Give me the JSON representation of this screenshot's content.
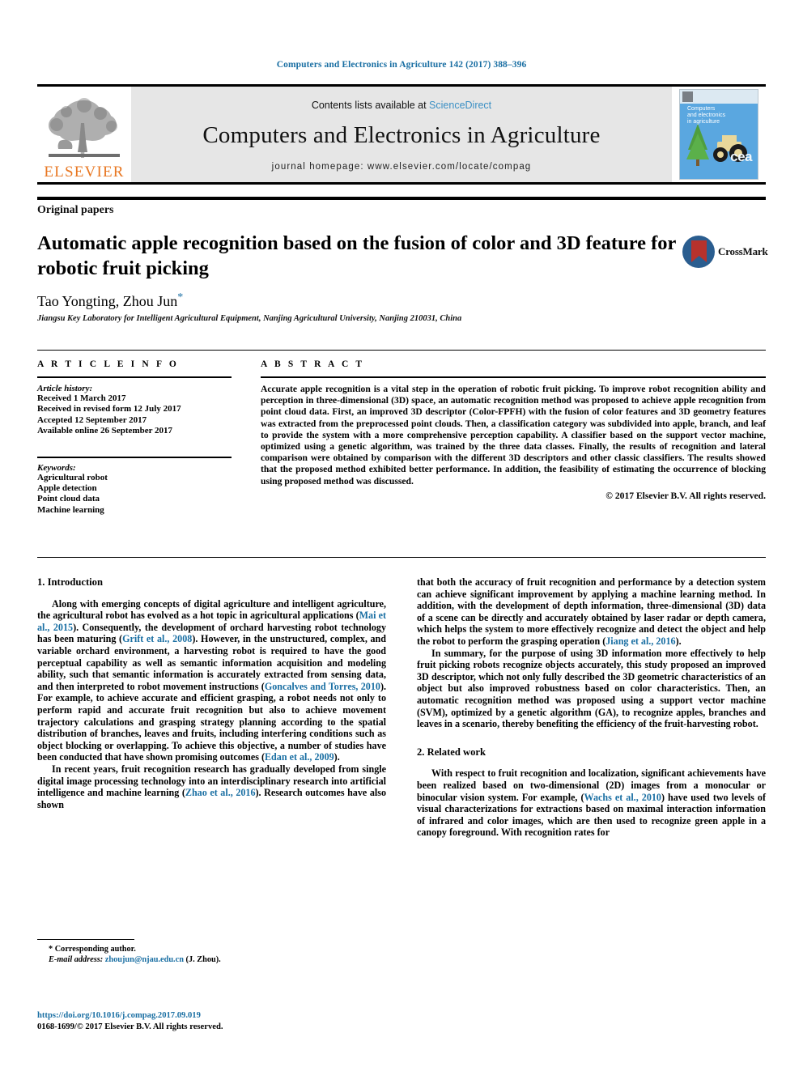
{
  "running_head": "Computers and Electronics in Agriculture 142 (2017) 388–396",
  "masthead": {
    "contents_prefix": "Contents lists available at ",
    "sciencedirect": "ScienceDirect",
    "journal_title": "Computers and Electronics in Agriculture",
    "homepage": "journal homepage: www.elsevier.com/locate/compag",
    "publisher_name": "ELSEVIER",
    "cover_title": "Computers\nand electronics\nin agriculture",
    "cover_abbrev": "cea"
  },
  "article": {
    "kicker": "Original papers",
    "title": "Automatic apple recognition based on the fusion of color and 3D feature for robotic fruit picking",
    "crossmark_label": "CrossMark",
    "authors": "Tao Yongting, Zhou Jun",
    "author_footnote_marker": "*",
    "affiliation": "Jiangsu Key Laboratory for Intelligent Agricultural Equipment, Nanjing Agricultural University, Nanjing 210031, China"
  },
  "article_info": {
    "heading": "A R T I C L E   I N F O",
    "history_label": "Article history:",
    "history": [
      "Received 1 March 2017",
      "Received in revised form 12 July 2017",
      "Accepted 12 September 2017",
      "Available online 26 September 2017"
    ],
    "keywords_label": "Keywords:",
    "keywords": [
      "Agricultural robot",
      "Apple detection",
      "Point cloud data",
      "Machine learning"
    ]
  },
  "abstract": {
    "heading": "A B S T R A C T",
    "text": "Accurate apple recognition is a vital step in the operation of robotic fruit picking. To improve robot recognition ability and perception in three-dimensional (3D) space, an automatic recognition method was proposed to achieve apple recognition from point cloud data. First, an improved 3D descriptor (Color-FPFH) with the fusion of color features and 3D geometry features was extracted from the preprocessed point clouds. Then, a classification category was subdivided into apple, branch, and leaf to provide the system with a more comprehensive perception capability. A classifier based on the support vector machine, optimized using a genetic algorithm, was trained by the three data classes. Finally, the results of recognition and lateral comparison were obtained by comparison with the different 3D descriptors and other classic classifiers. The results showed that the proposed method exhibited better performance. In addition, the feasibility of estimating the occurrence of blocking using proposed method was discussed.",
    "copyright": "© 2017 Elsevier B.V. All rights reserved."
  },
  "body": {
    "section1_heading": "1. Introduction",
    "section2_heading": "2. Related work",
    "left_paragraphs": [
      "Along with emerging concepts of digital agriculture and intelligent agriculture, the agricultural robot has evolved as a hot topic in agricultural applications (Mai et al., 2015). Consequently, the development of orchard harvesting robot technology has been maturing (Grift et al., 2008). However, in the unstructured, complex, and variable orchard environment, a harvesting robot is required to have the good perceptual capability as well as semantic information acquisition and modeling ability, such that semantic information is accurately extracted from sensing data, and then interpreted to robot movement instructions (Goncalves and Torres, 2010). For example, to achieve accurate and efficient grasping, a robot needs not only to perform rapid and accurate fruit recognition but also to achieve movement trajectory calculations and grasping strategy planning according to the spatial distribution of branches, leaves and fruits, including interfering conditions such as object blocking or overlapping. To achieve this objective, a number of studies have been conducted that have shown promising outcomes (Edan et al., 2009).",
      "In recent years, fruit recognition research has gradually developed from single digital image processing technology into an interdisciplinary research into artificial intelligence and machine learning (Zhao et al., 2016). Research outcomes have also shown"
    ],
    "right_paragraphs": [
      "that both the accuracy of fruit recognition and performance by a detection system can achieve significant improvement by applying a machine learning method. In addition, with the development of depth information, three-dimensional (3D) data of a scene can be directly and accurately obtained by laser radar or depth camera, which helps the system to more effectively recognize and detect the object and help the robot to perform the grasping operation (Jiang et al., 2016).",
      "In summary, for the purpose of using 3D information more effectively to help fruit picking robots recognize objects accurately, this study proposed an improved 3D descriptor, which not only fully described the 3D geometric characteristics of an object but also improved robustness based on color characteristics. Then, an automatic recognition method was proposed using a support vector machine (SVM), optimized by a genetic algorithm (GA), to recognize apples, branches and leaves in a scenario, thereby benefiting the efficiency of the fruit-harvesting robot.",
      "With respect to fruit recognition and localization, significant achievements have been realized based on two-dimensional (2D) images from a monocular or binocular vision system. For example, (Wachs et al., 2010) have used two levels of visual characterizations for extractions based on maximal interaction information of infrared and color images, which are then used to recognize green apple in a canopy foreground. With recognition rates for"
    ],
    "citation_links": [
      "Mai et al., 2015",
      "Grift et al., 2008",
      "Goncalves and Torres, 2010",
      "Edan et al., 2009",
      "Zhao et al., 2016",
      "Jiang et al., 2016",
      "Wachs et al., 2010"
    ]
  },
  "footer": {
    "corresponding_marker": "*",
    "corresponding_label": "Corresponding author.",
    "email_label": "E-mail address:",
    "email": "zhoujun@njau.edu.cn",
    "email_person": "(J. Zhou).",
    "doi": "https://doi.org/10.1016/j.compag.2017.09.019",
    "issn_line": "0168-1699/© 2017 Elsevier B.V. All rights reserved."
  },
  "colors": {
    "link": "#1a6fa3",
    "elsevier_orange": "#e87722",
    "masthead_grey": "#e6e6e6",
    "cover_blue": "#5aa7e0"
  }
}
